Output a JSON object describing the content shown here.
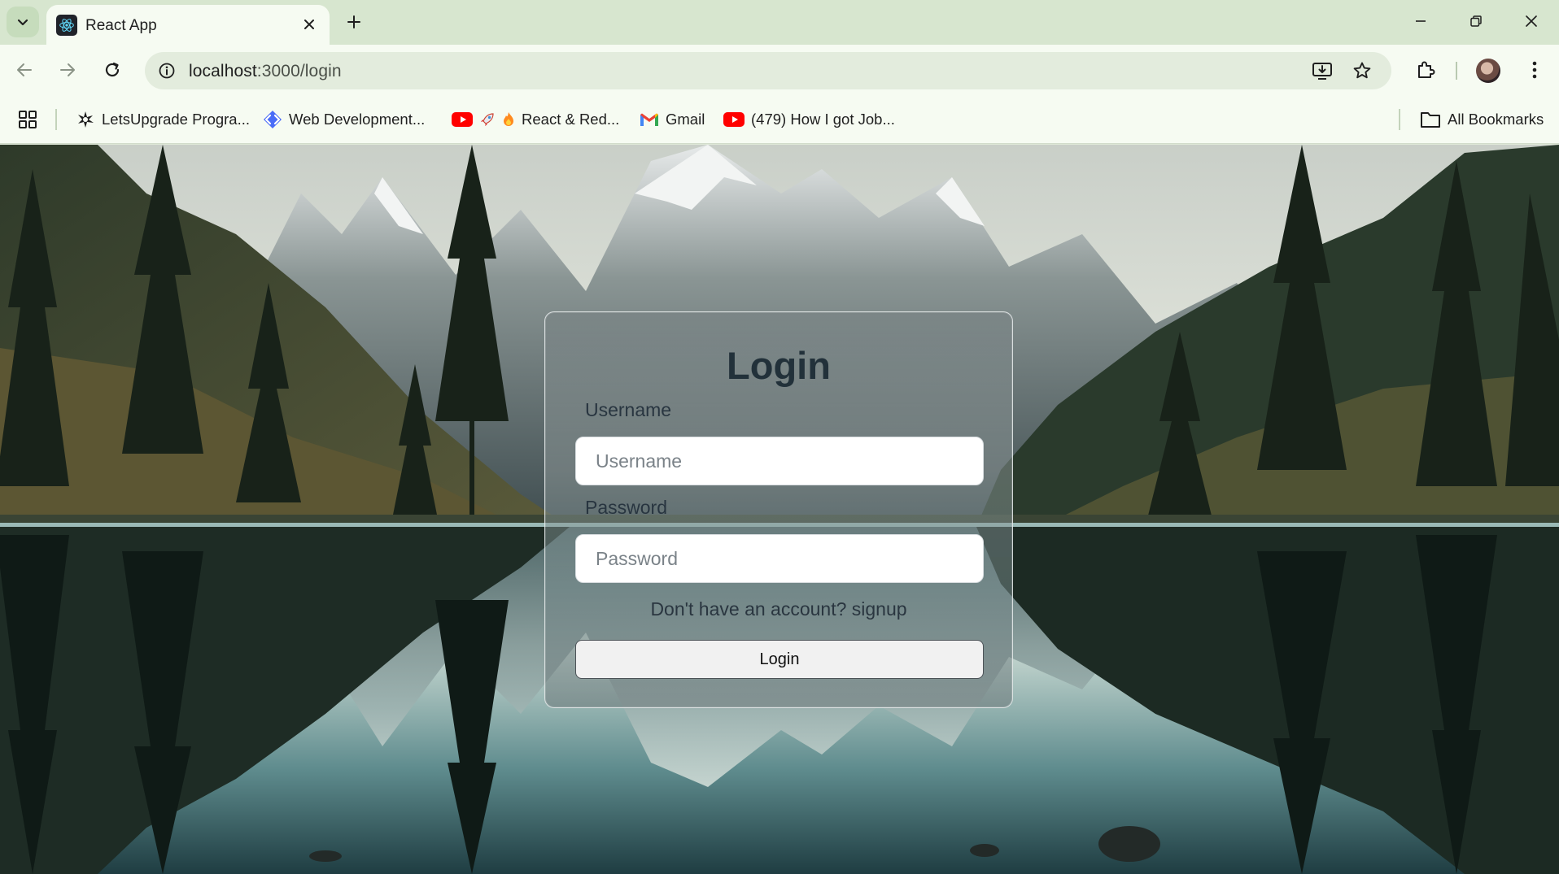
{
  "browser": {
    "tab": {
      "title": "React App"
    },
    "url": {
      "host": "localhost",
      "path": ":3000/login"
    },
    "bookmarks": [
      {
        "label": "LetsUpgrade Progra...",
        "icon": "letsupgrade-icon"
      },
      {
        "label": "Web Development...",
        "icon": "web-dev-icon"
      },
      {
        "label": "React & Red...",
        "icon": "youtube-rocket-fire-icon"
      },
      {
        "label": "Gmail",
        "icon": "gmail-icon"
      },
      {
        "label": "(479) How I got Job...",
        "icon": "youtube-icon"
      }
    ],
    "all_bookmarks_label": "All Bookmarks"
  },
  "login": {
    "title": "Login",
    "username_label": "Username",
    "username_placeholder": "Username",
    "password_label": "Password",
    "password_placeholder": "Password",
    "signup_prompt": "Don't have an account?",
    "signup_link": "signup",
    "submit_label": "Login"
  },
  "colors": {
    "chrome_accent": "#d7e6cf",
    "toolbar_bg": "#f6fbf2",
    "card_title": "#22313a"
  }
}
